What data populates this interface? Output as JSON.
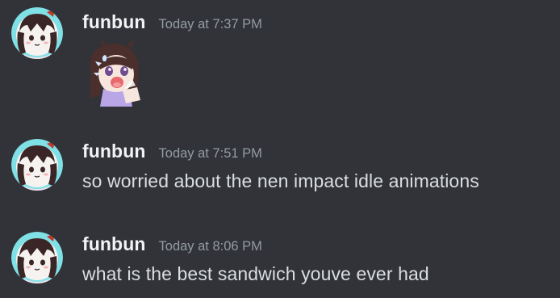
{
  "messages": [
    {
      "username": "funbun",
      "timestamp": "Today at 7:37 PM",
      "content": "",
      "sticker_icon": "crying-anime-girl-sticker"
    },
    {
      "username": "funbun",
      "timestamp": "Today at 7:51 PM",
      "content": "so worried about the nen impact idle animations"
    },
    {
      "username": "funbun",
      "timestamp": "Today at 8:06 PM",
      "content": "what is the best sandwich youve ever had"
    }
  ],
  "colors": {
    "background": "#313338",
    "username": "#f2f3f5",
    "timestamp": "#949ba4",
    "message_text": "#dbdee1",
    "avatar_ring": "#7fe0e6"
  },
  "avatar_icon": "anime-girl-avatar"
}
